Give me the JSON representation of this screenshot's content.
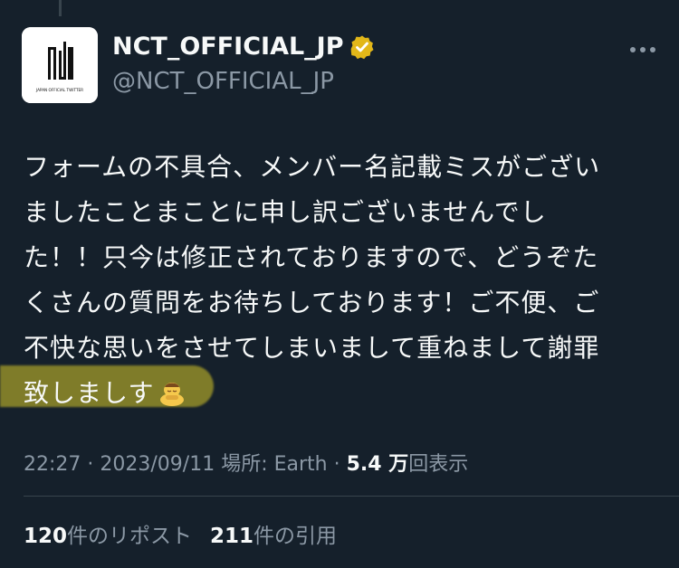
{
  "author": {
    "display_name": "NCT_OFFICIAL_JP",
    "handle": "@NCT_OFFICIAL_JP",
    "avatar_caption": "JAPAN OFFICIAL TWITTER",
    "verified_icon": "verified-badge-icon",
    "verified_color": "#e2b719"
  },
  "more_icon": "more-dots-icon",
  "tweet": {
    "lines": [
      "フォームの不具合、メンバー名記載ミスがござい",
      "ましたことまことに申し訳ございませんでし",
      "た！！只今は修正されておりますので、どうぞた",
      "くさんの質問をお待ちしております！ご不便、ご",
      "不快な思いをさせてしまいまして重ねまして謝罪",
      "致しましす"
    ],
    "emoji": "bowing-person-emoji",
    "highlight_color": "#d7c828"
  },
  "meta": {
    "time": "22:27",
    "date": "2023/09/11",
    "location": "場所: Earth",
    "views_count": "5.4 万",
    "views_label": "回表示",
    "separator": "·"
  },
  "stats": {
    "reposts_count": "120",
    "reposts_label": "件のリポスト",
    "quotes_count": "211",
    "quotes_label": "件の引用"
  },
  "colors": {
    "background": "#15202b",
    "text": "#f7f9f9",
    "muted": "#8b98a5"
  }
}
